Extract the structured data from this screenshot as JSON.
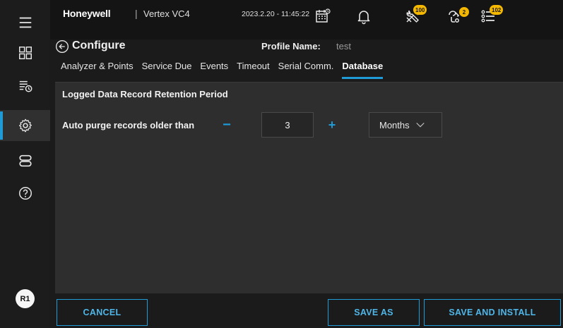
{
  "header": {
    "brand": "Honeywell",
    "separator": "|",
    "product": "Vertex VC4",
    "datetime": "2023.2.20 - 11:45:22",
    "badges": {
      "maintenance": "100",
      "diagnostics": "2",
      "events": "102"
    }
  },
  "sidebar": {
    "items": [
      {
        "icon": "menu-icon"
      },
      {
        "icon": "dashboard-icon"
      },
      {
        "icon": "event-list-icon"
      },
      {
        "icon": "gear-icon",
        "active": true
      },
      {
        "icon": "storage-icon"
      },
      {
        "icon": "help-icon"
      }
    ],
    "avatar": "R1"
  },
  "page": {
    "title": "Configure",
    "profile_label": "Profile Name:",
    "profile_value": "test"
  },
  "tabs": [
    {
      "label": "Analyzer & Points",
      "active": false
    },
    {
      "label": "Service Due",
      "active": false
    },
    {
      "label": "Events",
      "active": false
    },
    {
      "label": "Timeout",
      "active": false
    },
    {
      "label": "Serial Comm.",
      "active": false
    },
    {
      "label": "Database",
      "active": true
    }
  ],
  "database": {
    "section_title": "Logged Data Record Retention Period",
    "auto_purge_label": "Auto purge records older than",
    "minus_symbol": "−",
    "value": "3",
    "plus_symbol": "+",
    "unit": "Months"
  },
  "footer": {
    "cancel": "CANCEL",
    "save_as": "SAVE AS",
    "save_and_install": "SAVE AND INSTALL"
  },
  "colors": {
    "accent": "#1f9bd8",
    "badge": "#f5b800",
    "background": "#1b1b1b",
    "panel": "#2e2e2e"
  }
}
